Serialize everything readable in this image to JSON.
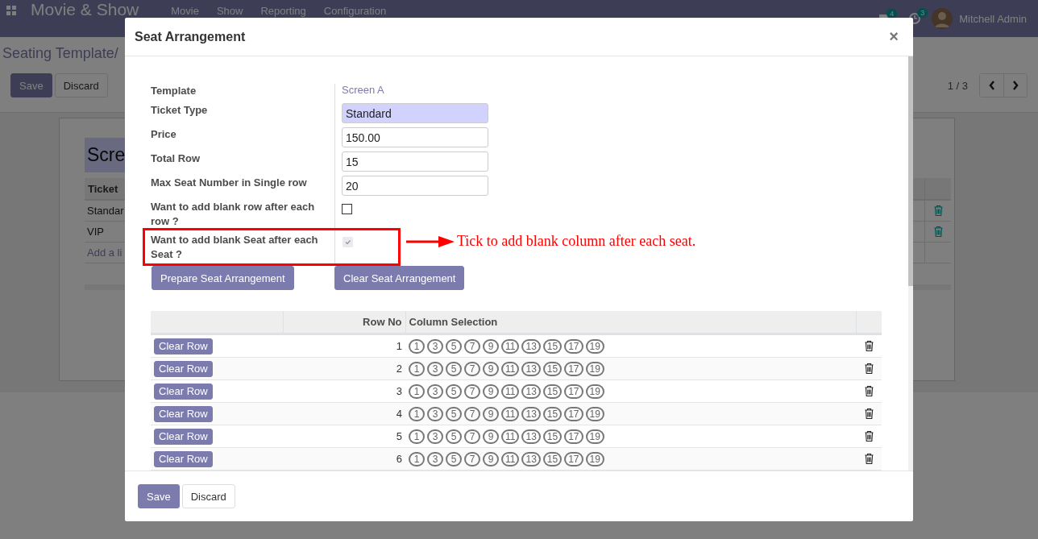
{
  "navbar": {
    "app_title": "Movie & Show",
    "menu": [
      "Movie",
      "Show",
      "Reporting",
      "Configuration"
    ],
    "messages_badge": "4",
    "activities_badge": "3",
    "user": "Mitchell Admin"
  },
  "control_panel": {
    "breadcrumb": "Seating Template/",
    "save": "Save",
    "discard": "Discard",
    "pager": "1 / 3"
  },
  "sheet": {
    "title": "Scre",
    "column": "Ticket",
    "rows": [
      "Standar",
      "VIP"
    ],
    "add_line": "Add a li"
  },
  "dialog": {
    "title": "Seat Arrangement",
    "close": "×",
    "fields": [
      {
        "kind": "link",
        "label": "Template",
        "value": "Screen A"
      },
      {
        "kind": "input",
        "label": "Ticket Type",
        "value": "Standard",
        "required": true
      },
      {
        "kind": "input",
        "label": "Price",
        "value": "150.00",
        "required": false
      },
      {
        "kind": "input",
        "label": "Total Row",
        "value": "15",
        "required": false
      },
      {
        "kind": "input",
        "label": "Max Seat Number in Single row",
        "value": "20",
        "required": false
      },
      {
        "kind": "checkbox",
        "label": "Want to add blank row after each row ?",
        "checked": false
      },
      {
        "kind": "checkbox",
        "label": "Want to add blank Seat after each Seat ?",
        "checked": true,
        "annotation": "Tick to add blank column after each seat."
      }
    ],
    "actions": [
      "Prepare Seat Arrangement",
      "Clear Seat Arrangement"
    ],
    "seat_table": {
      "columns": [
        "Row No",
        "Column Selection"
      ],
      "rows": [
        {
          "button": "Clear Row",
          "row_no": "1",
          "seats": [
            "1",
            "3",
            "5",
            "7",
            "9",
            "11",
            "13",
            "15",
            "17",
            "19"
          ]
        },
        {
          "button": "Clear Row",
          "row_no": "2",
          "seats": [
            "1",
            "3",
            "5",
            "7",
            "9",
            "11",
            "13",
            "15",
            "17",
            "19"
          ]
        },
        {
          "button": "Clear Row",
          "row_no": "3",
          "seats": [
            "1",
            "3",
            "5",
            "7",
            "9",
            "11",
            "13",
            "15",
            "17",
            "19"
          ]
        },
        {
          "button": "Clear Row",
          "row_no": "4",
          "seats": [
            "1",
            "3",
            "5",
            "7",
            "9",
            "11",
            "13",
            "15",
            "17",
            "19"
          ]
        },
        {
          "button": "Clear Row",
          "row_no": "5",
          "seats": [
            "1",
            "3",
            "5",
            "7",
            "9",
            "11",
            "13",
            "15",
            "17",
            "19"
          ]
        },
        {
          "button": "Clear Row",
          "row_no": "6",
          "seats": [
            "1",
            "3",
            "5",
            "7",
            "9",
            "11",
            "13",
            "15",
            "17",
            "19"
          ]
        }
      ]
    },
    "footer_buttons": [
      "Save",
      "Discard"
    ]
  }
}
